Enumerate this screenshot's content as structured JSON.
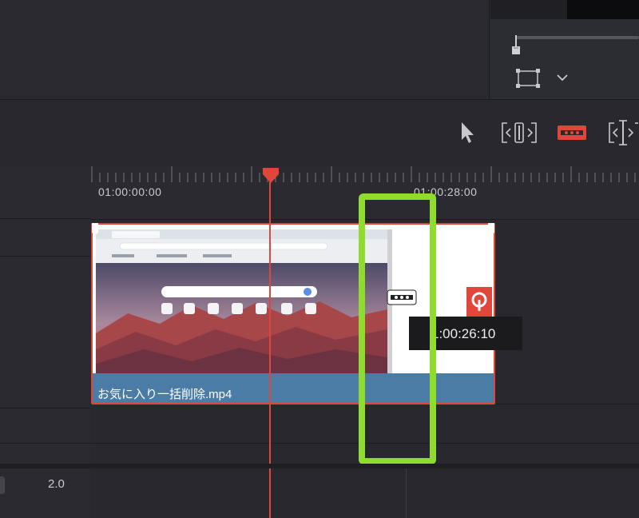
{
  "ruler": {
    "timecodes": [
      "01:00:00:00",
      "01:00:28:00"
    ]
  },
  "clip": {
    "name": "お気に入り一括削除.mp4",
    "hover_timecode": "1:00:26:10"
  },
  "track": {
    "speed": "2.0"
  },
  "colors": {
    "accent_red": "#e0463a",
    "highlight_green": "#8fdc2e",
    "clip_blue": "#4a7ca6"
  },
  "icons": {
    "selection": "arrow-pointer-icon",
    "trim": "trim-edit-icon",
    "blade": "razor-blade-icon",
    "dynamic_trim": "dynamic-trim-icon"
  }
}
